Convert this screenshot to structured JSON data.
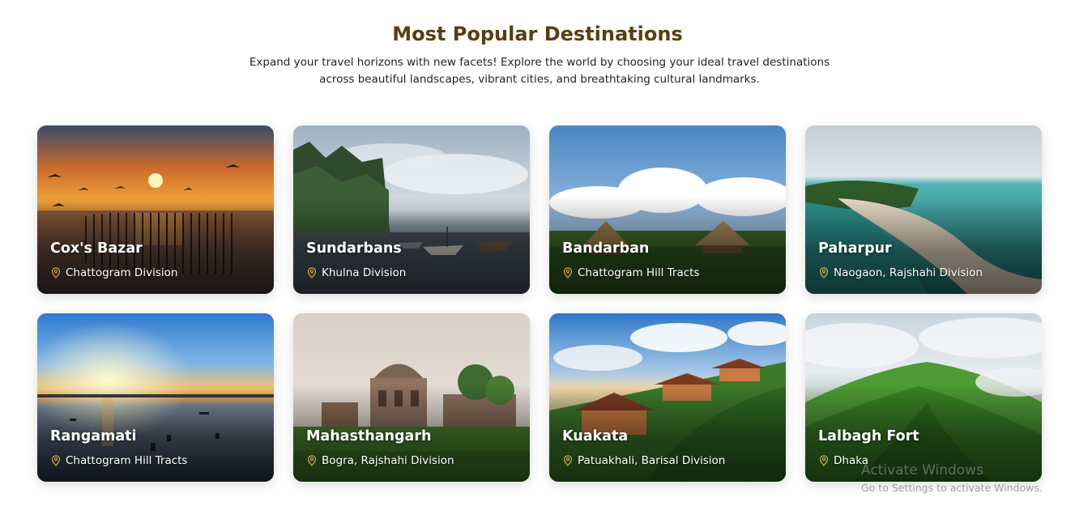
{
  "header": {
    "title": "Most Popular Destinations",
    "subtitle_line1": "Expand your travel horizons with new facets! Explore the world by choosing your ideal travel destinations",
    "subtitle_line2": "across beautiful landscapes, vibrant cities, and breathtaking cultural landmarks."
  },
  "destinations": [
    {
      "name": "Cox's Bazar",
      "location": "Chattogram Division",
      "scene": "sunset-sea"
    },
    {
      "name": "Sundarbans",
      "location": "Khulna Division",
      "scene": "mangrove-boats"
    },
    {
      "name": "Bandarban",
      "location": "Chattogram Hill Tracts",
      "scene": "huts-field"
    },
    {
      "name": "Paharpur",
      "location": "Naogaon, Rajshahi Division",
      "scene": "island-beach"
    },
    {
      "name": "Rangamati",
      "location": "Chattogram Hill Tracts",
      "scene": "lake-sunrise"
    },
    {
      "name": "Mahasthangarh",
      "location": "Bogra, Rajshahi Division",
      "scene": "domed-ruins"
    },
    {
      "name": "Kuakata",
      "location": "Patuakhali, Barisal Division",
      "scene": "tea-garden-houses"
    },
    {
      "name": "Lalbagh Fort",
      "location": "Dhaka",
      "scene": "green-hills-clouds"
    }
  ],
  "icons": {
    "location": "map-pin-icon"
  },
  "colors": {
    "title": "#5a3d12",
    "pin": "#d4b24c"
  },
  "watermark": {
    "line1": "Activate Windows",
    "line2": "Go to Settings to activate Windows."
  }
}
